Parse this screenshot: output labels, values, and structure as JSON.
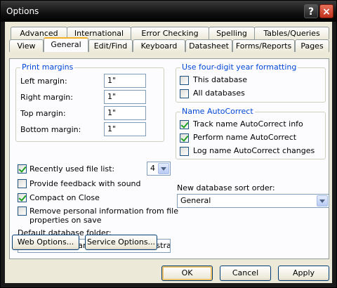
{
  "window": {
    "title": "Options",
    "help_label": "?",
    "close_label": "×"
  },
  "tabs_row1": [
    "Advanced",
    "International",
    "Error Checking",
    "Spelling",
    "Tables/Queries"
  ],
  "tabs_row2": [
    "View",
    "General",
    "Edit/Find",
    "Keyboard",
    "Datasheet",
    "Forms/Reports",
    "Pages"
  ],
  "active_tab": "General",
  "print_margins": {
    "title": "Print margins",
    "left_label": "Left margin:",
    "left_value": "1\"",
    "right_label": "Right margin:",
    "right_value": "1\"",
    "top_label": "Top margin:",
    "top_value": "1\"",
    "bottom_label": "Bottom margin:",
    "bottom_value": "1\""
  },
  "year_format": {
    "title": "Use four-digit year formatting",
    "this_db": {
      "label": "This database",
      "checked": false
    },
    "all_db": {
      "label": "All databases",
      "checked": false
    }
  },
  "autocorrect": {
    "title": "Name AutoCorrect",
    "track": {
      "label": "Track name AutoCorrect info",
      "checked": true
    },
    "perform": {
      "label": "Perform name AutoCorrect",
      "checked": true
    },
    "log": {
      "label": "Log name AutoCorrect changes",
      "checked": false
    }
  },
  "options": {
    "recent_files": {
      "label": "Recently used file list:",
      "checked": true,
      "count": "4"
    },
    "feedback": {
      "label": "Provide feedback with sound",
      "checked": false
    },
    "compact": {
      "label": "Compact on Close",
      "checked": true
    },
    "remove_info": {
      "label_line1": "Remove personal information from file",
      "label_line2": "properties on save",
      "checked": false
    }
  },
  "sort_order": {
    "label": "New database sort order:",
    "value": "General"
  },
  "default_folder": {
    "label": "Default database folder:",
    "value": "C:\\Documents and Settings\\Administrator\\My Documents"
  },
  "buttons": {
    "web_options": "Web Options...",
    "service_options": "Service Options...",
    "ok": "OK",
    "cancel": "Cancel",
    "apply": "Apply"
  }
}
